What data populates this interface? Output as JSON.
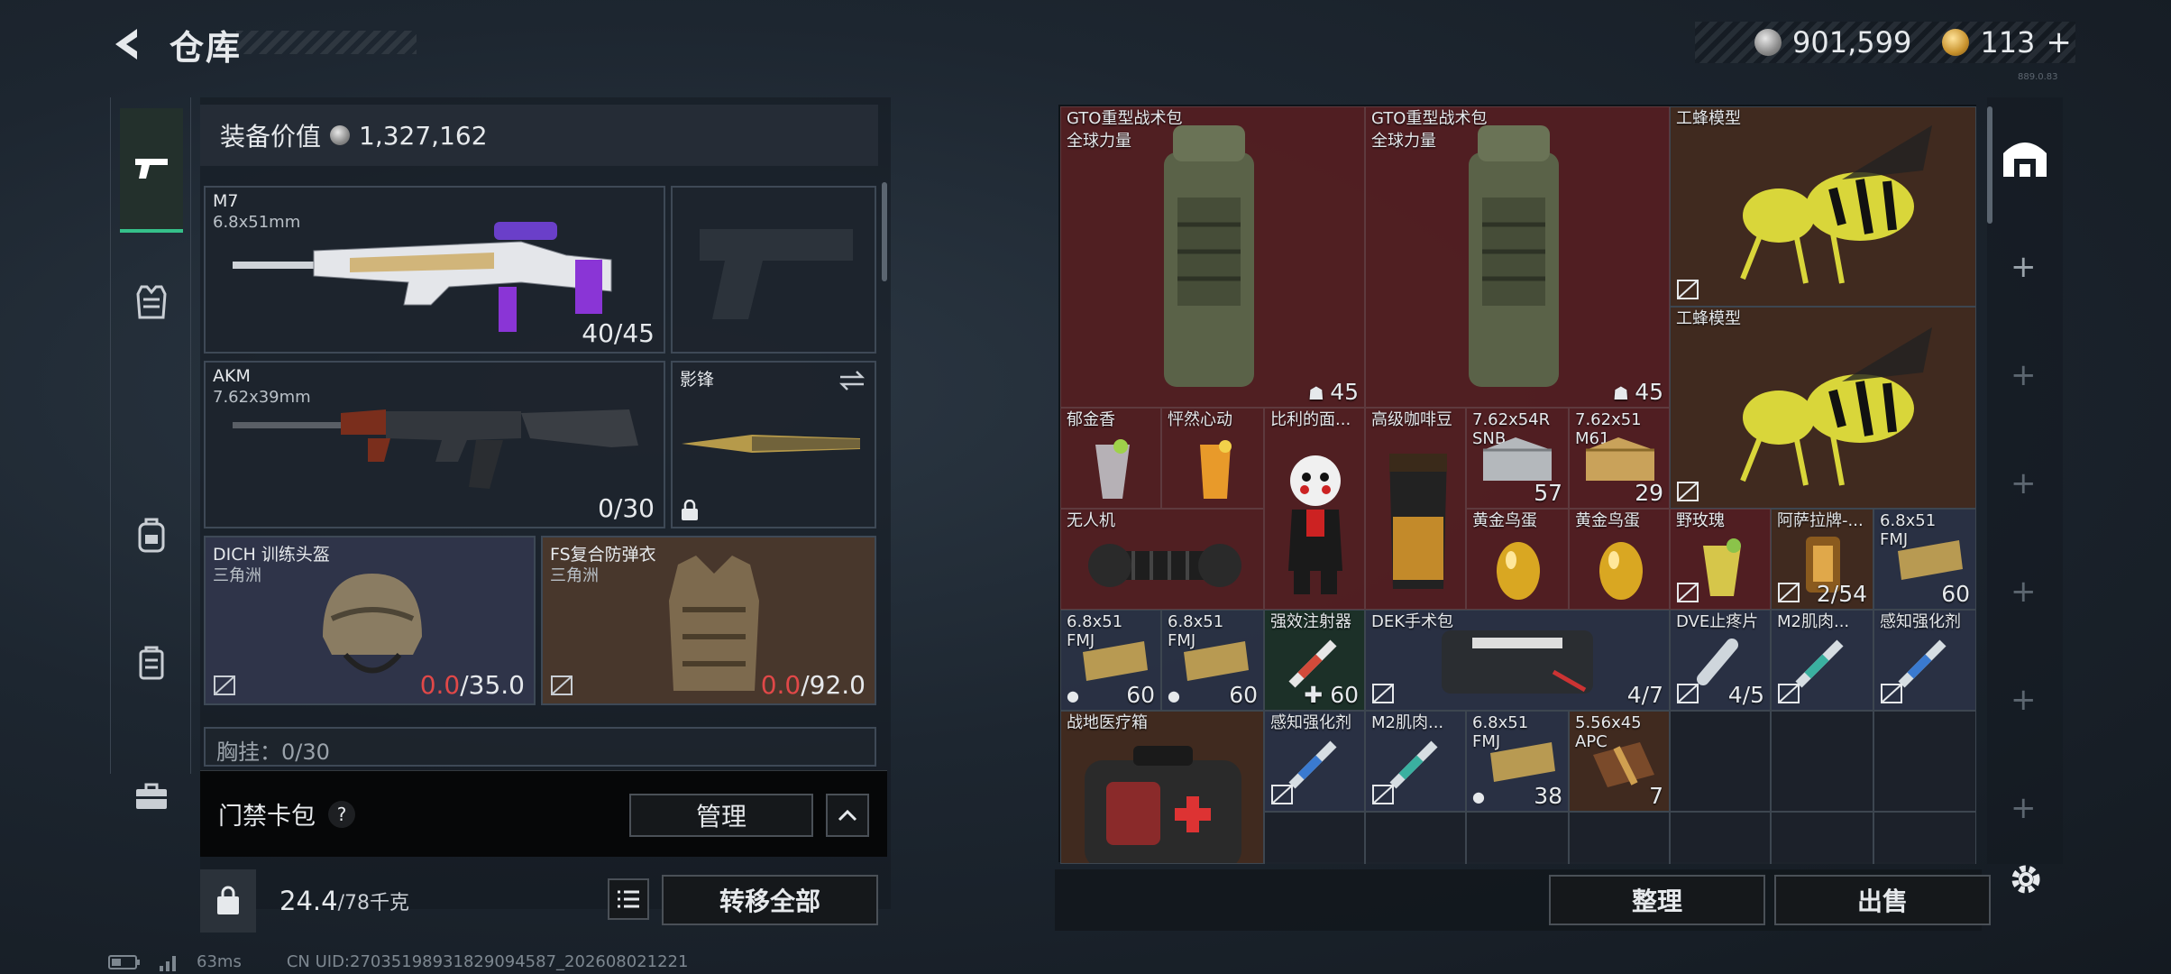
{
  "header": {
    "title": "仓库",
    "currency_silver": "901,599",
    "currency_gold": "113",
    "plus": "+",
    "version": "889.0.83"
  },
  "equipment": {
    "value_label": "装备价值",
    "value": "1,327,162",
    "primary": {
      "name": "M7",
      "caliber": "6.8x51mm",
      "ammo": "40/45"
    },
    "secondary": {
      "name": "AKM",
      "caliber": "7.62x39mm",
      "ammo": "0/30"
    },
    "melee": {
      "name": "影锋"
    },
    "helmet": {
      "name": "DICH 训练头盔",
      "map": "三角洲",
      "dur_current": "0.0",
      "dur_max": "/35.0"
    },
    "armor": {
      "name": "FS复合防弹衣",
      "map": "三角洲",
      "dur_current": "0.0",
      "dur_max": "/92.0"
    },
    "chest_rig": "胸挂：0/30",
    "card_pack": "门禁卡包",
    "card_pack_help": "?",
    "manage": "管理",
    "weight": "24.4",
    "weight_max": "/78千克",
    "transfer_all": "转移全部"
  },
  "stash": {
    "items": [
      {
        "name": "GTO重型战术包",
        "sub": "全球力量",
        "qty": "45"
      },
      {
        "name": "GTO重型战术包",
        "sub": "全球力量",
        "qty": "45"
      },
      {
        "name": "工蜂模型"
      },
      {
        "name": "工蜂模型"
      },
      {
        "name": "郁金香"
      },
      {
        "name": "怦然心动"
      },
      {
        "name": "比利的面..."
      },
      {
        "name": "高级咖啡豆"
      },
      {
        "name": "7.62x54R",
        "sub": "SNB",
        "qty": "57"
      },
      {
        "name": "7.62x51",
        "sub": "M61",
        "qty": "29"
      },
      {
        "name": "无人机"
      },
      {
        "name": "黄金鸟蛋"
      },
      {
        "name": "黄金鸟蛋"
      },
      {
        "name": "野玫瑰"
      },
      {
        "name": "阿萨拉牌-...",
        "qty": "2/54"
      },
      {
        "name": "6.8x51",
        "sub": "FMJ",
        "qty": "60"
      },
      {
        "name": "6.8x51",
        "sub": "FMJ",
        "qty": "60"
      },
      {
        "name": "6.8x51",
        "sub": "FMJ",
        "qty": "60"
      },
      {
        "name": "强效注射器",
        "qty": "60"
      },
      {
        "name": "DEK手术包",
        "qty": "4/7"
      },
      {
        "name": "DVE止疼片",
        "qty": "4/5"
      },
      {
        "name": "M2肌肉..."
      },
      {
        "name": "感知强化剂"
      },
      {
        "name": "战地医疗箱"
      },
      {
        "name": "感知强化剂"
      },
      {
        "name": "M2肌肉..."
      },
      {
        "name": "6.8x51",
        "sub": "FMJ",
        "qty": "38"
      },
      {
        "name": "5.56x45",
        "sub": "APC",
        "qty": "7"
      }
    ],
    "sort": "整理",
    "sell": "出售"
  },
  "status": {
    "ping": "63ms",
    "uid": "CN UID:27035198931829094587_202608021221"
  },
  "colors": {
    "accent": "#35c08a",
    "broken": "#e04848"
  }
}
